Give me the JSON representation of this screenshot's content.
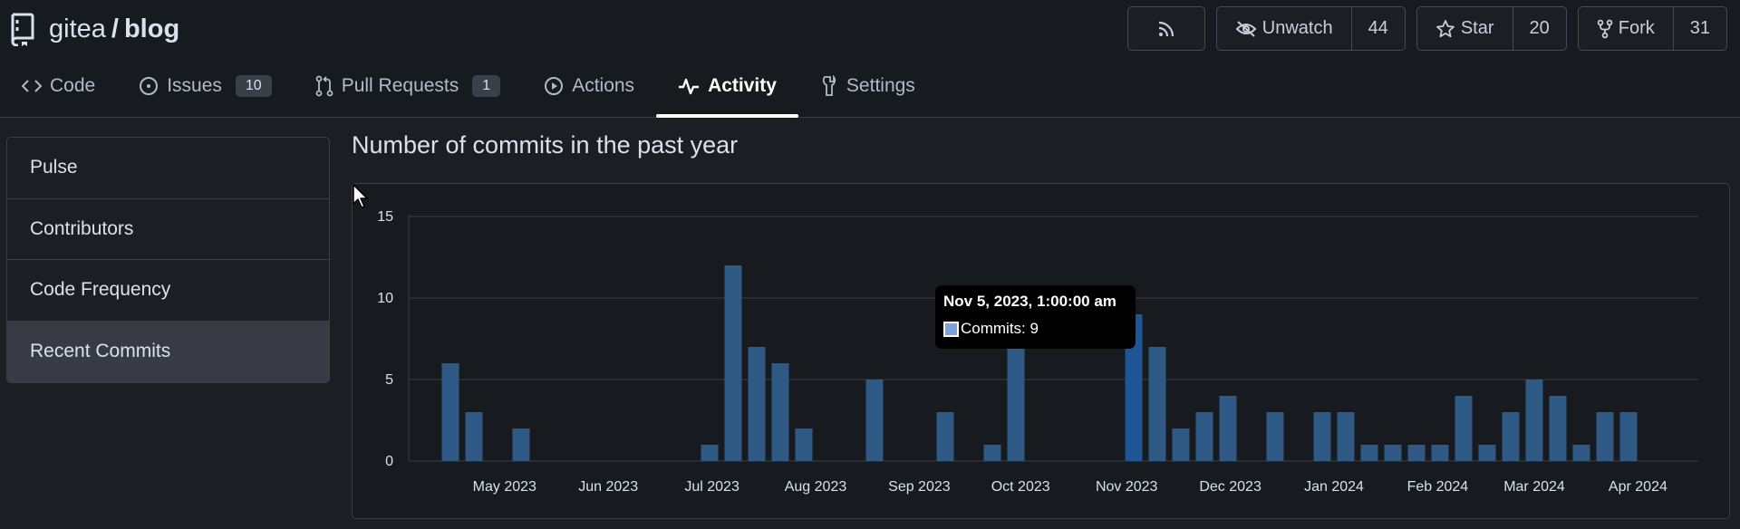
{
  "repo": {
    "owner": "gitea",
    "separator": "/",
    "name": "blog"
  },
  "actions": {
    "watch": {
      "label": "Unwatch",
      "count": "44"
    },
    "star": {
      "label": "Star",
      "count": "20"
    },
    "fork": {
      "label": "Fork",
      "count": "31"
    }
  },
  "tabs": [
    {
      "label": "Code",
      "icon": "code-icon",
      "badge": ""
    },
    {
      "label": "Issues",
      "icon": "issue-icon",
      "badge": "10"
    },
    {
      "label": "Pull Requests",
      "icon": "pull-request-icon",
      "badge": "1"
    },
    {
      "label": "Actions",
      "icon": "play-icon",
      "badge": ""
    },
    {
      "label": "Activity",
      "icon": "pulse-icon",
      "badge": "",
      "active": true
    },
    {
      "label": "Settings",
      "icon": "tools-icon",
      "badge": ""
    }
  ],
  "sidebar": {
    "items": [
      {
        "label": "Pulse"
      },
      {
        "label": "Contributors"
      },
      {
        "label": "Code Frequency"
      },
      {
        "label": "Recent Commits",
        "active": true
      }
    ]
  },
  "main": {
    "title": "Number of commits in the past year"
  },
  "colors": {
    "bar": "#2f5985",
    "bar_highlight": "#1d5596",
    "background": "#1c1e23",
    "header": "#171a1e",
    "border": "#3a3e46"
  },
  "tooltip": {
    "title": "Nov 5, 2023, 1:00:00 am",
    "label": "Commits: 9"
  },
  "chart_data": {
    "type": "bar",
    "x_start": "2023-04-16",
    "x_step": "1 week",
    "ylim": [
      0,
      15
    ],
    "yticks": [
      0,
      5,
      10,
      15
    ],
    "grid": true,
    "xticks": [
      "May 2023",
      "Jun 2023",
      "Jul 2023",
      "Aug 2023",
      "Sep 2023",
      "Oct 2023",
      "Nov 2023",
      "Dec 2023",
      "Jan 2024",
      "Feb 2024",
      "Mar 2024",
      "Apr 2024"
    ],
    "series": [
      {
        "name": "Commits",
        "values": [
          6,
          3,
          0,
          2,
          0,
          0,
          0,
          0,
          0,
          0,
          0,
          1,
          12,
          7,
          6,
          2,
          0,
          0,
          5,
          0,
          0,
          3,
          0,
          1,
          7,
          0,
          0,
          0,
          0,
          9,
          7,
          2,
          3,
          4,
          0,
          3,
          0,
          3,
          3,
          1,
          1,
          1,
          1,
          4,
          1,
          3,
          5,
          4,
          1,
          3,
          3
        ],
        "highlight_index": 29
      }
    ]
  }
}
